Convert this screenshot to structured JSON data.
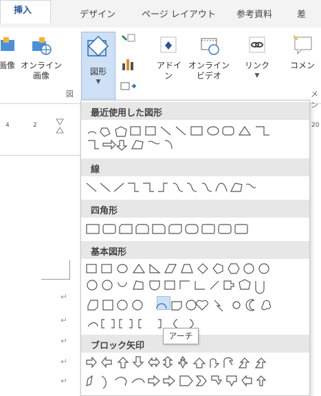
{
  "tabs": [
    "挿入",
    "デザイン",
    "ページ レイアウト",
    "参考資料",
    "差"
  ],
  "ribbon": {
    "image_label": "画像",
    "online_image_label": "オンライン\n画像",
    "shapes_label": "図形",
    "addin_label": "アドイ\nン",
    "online_video_label": "オンライン\nビデオ",
    "link_label": "リンク",
    "comment_label": "コメン",
    "group_label": "図",
    "group_label_right": "メン"
  },
  "ruler": {
    "num1": "4",
    "num2": "2",
    "num3": "20"
  },
  "gallery": {
    "section_recent": "最近使用した図形",
    "section_lines": "線",
    "section_rect": "四角形",
    "section_basic": "基本図形",
    "section_block": "ブロック矢印"
  },
  "tooltip": "アーチ",
  "colors": {
    "accent": "#2b579a",
    "highlight": "#cde0f6"
  }
}
